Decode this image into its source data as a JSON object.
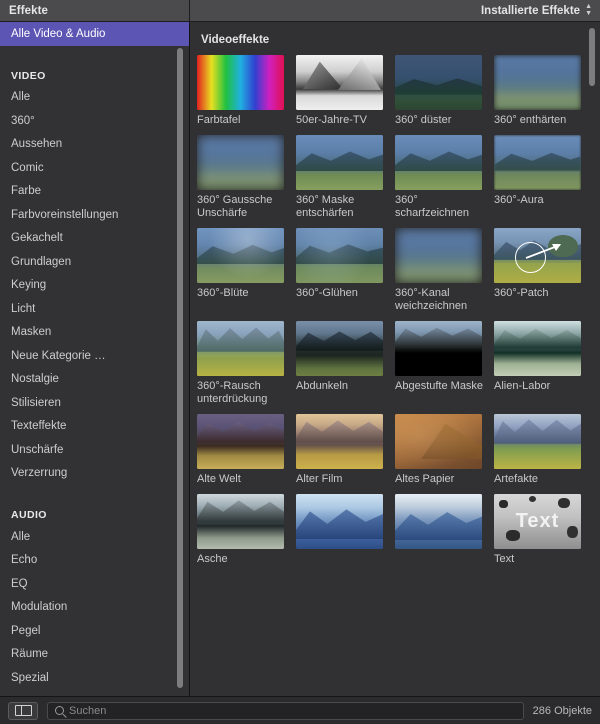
{
  "header": {
    "title": "Effekte",
    "popup_label": "Installierte Effekte",
    "popup_icon": "chevron-up-down-icon"
  },
  "sidebar": {
    "selected_item": "Alle Video & Audio",
    "video_header": "VIDEO",
    "audio_header": "AUDIO",
    "video_items": [
      "Alle",
      "360°",
      "Aussehen",
      "Comic",
      "Farbe",
      "Farbvoreinstellungen",
      "Gekachelt",
      "Grundlagen",
      "Keying",
      "Licht",
      "Masken",
      "Neue Kategorie …",
      "Nostalgie",
      "Stilisieren",
      "Texteffekte",
      "Unschärfe",
      "Verzerrung"
    ],
    "audio_items": [
      "Alle",
      "Echo",
      "EQ",
      "Modulation",
      "Pegel",
      "Räume",
      "Spezial"
    ]
  },
  "content": {
    "section_title": "Videoeffekte",
    "effects": [
      {
        "label": "Farbtafel",
        "art": "rainbow"
      },
      {
        "label": "50er-Jahre-TV",
        "art": "bw-mountain"
      },
      {
        "label": "360° düster",
        "art": "dark-landscape"
      },
      {
        "label": "360° enthärten",
        "art": "blur-soft"
      },
      {
        "label": "360° Gaussche Unschärfe",
        "art": "blur-heavy"
      },
      {
        "label": "360° Maske entschärfen",
        "art": "landscape-sharp"
      },
      {
        "label": "360° scharfzeichnen",
        "art": "landscape-sharp"
      },
      {
        "label": "360°-Aura",
        "art": "landscape-soft"
      },
      {
        "label": "360°-Blüte",
        "art": "landscape-bloom"
      },
      {
        "label": "360°-Glühen",
        "art": "landscape-glow"
      },
      {
        "label": "360°-Kanal weichzeichnen",
        "art": "blur-heavy"
      },
      {
        "label": "360°-Patch",
        "art": "patch",
        "selected": true
      },
      {
        "label": "360°-Rausch unterdrückung",
        "art": "meadow-bright"
      },
      {
        "label": "Abdunkeln",
        "art": "darkened"
      },
      {
        "label": "Abgestufte Maske",
        "art": "gradient-mask"
      },
      {
        "label": "Alien-Labor",
        "art": "alien"
      },
      {
        "label": "Alte Welt",
        "art": "old-world"
      },
      {
        "label": "Alter Film",
        "art": "old-film"
      },
      {
        "label": "Altes Papier",
        "art": "old-paper"
      },
      {
        "label": "Artefakte",
        "art": "artifacts"
      },
      {
        "label": "Asche",
        "art": "ash"
      },
      {
        "label": "",
        "art": "blue-mountain"
      },
      {
        "label": "",
        "art": "blue-mountain2"
      },
      {
        "label": "Text",
        "art": "grunge-text"
      }
    ]
  },
  "statusbar": {
    "toggle_icon": "sidebar-toggle-icon",
    "search_icon": "search-icon",
    "search_value": "",
    "search_placeholder": "Suchen",
    "object_count": "286 Objekte"
  },
  "colors": {
    "selection": "#5d55b4",
    "header_bg": "#4b4b4e",
    "sidebar_bg": "#323234",
    "content_bg": "#313133"
  }
}
